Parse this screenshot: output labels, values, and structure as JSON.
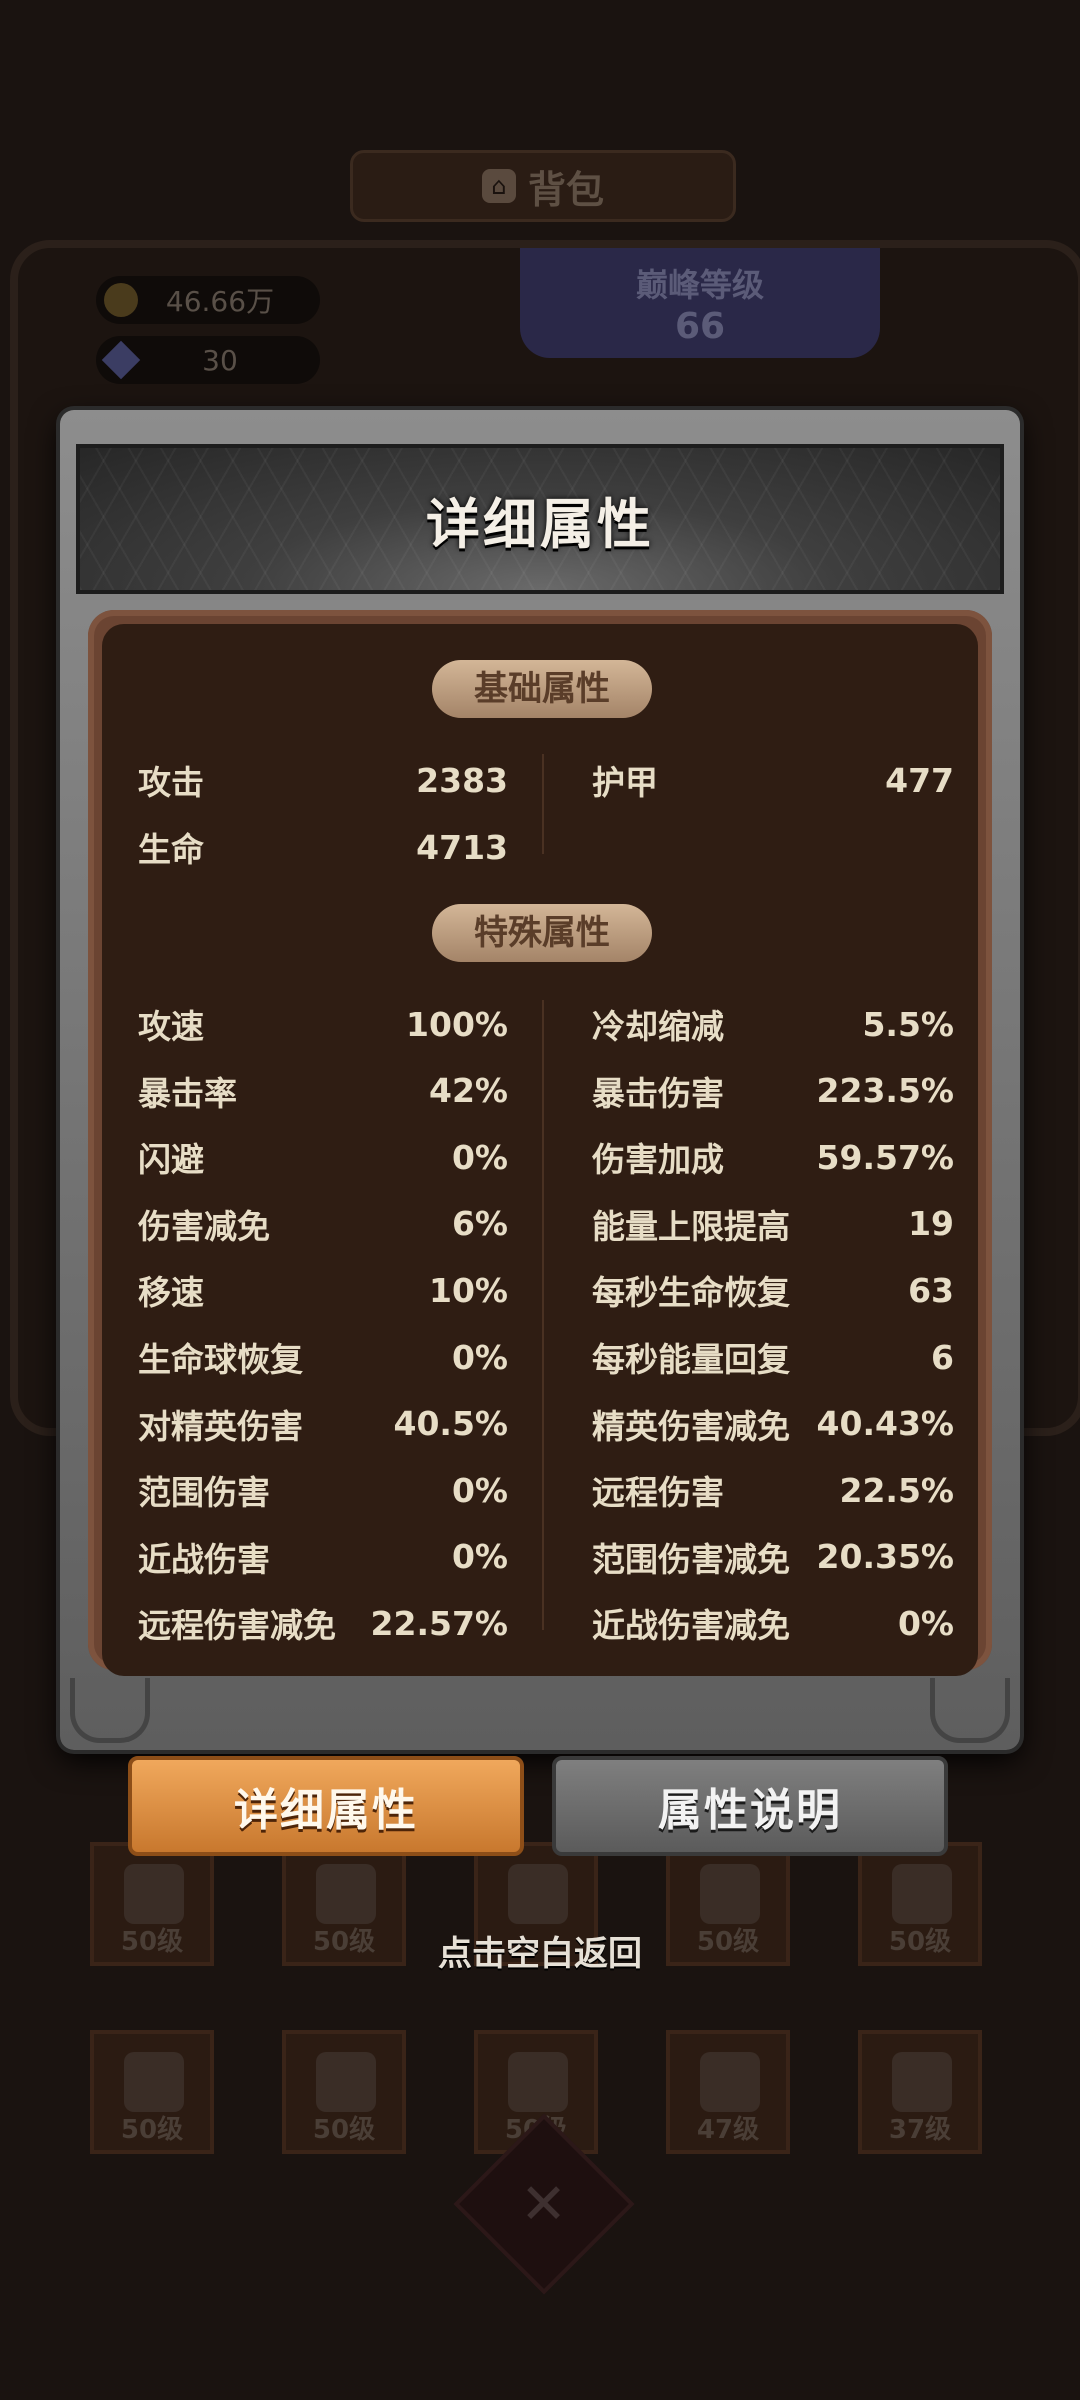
{
  "background": {
    "bag_title": "背包",
    "gold": "46.66万",
    "gems": "30",
    "peak_level_label": "巅峰等级",
    "peak_level_value": "66",
    "slot_levels_row1": [
      "50级",
      "50级",
      "",
      "50级",
      "50级"
    ],
    "slot_levels_row2": [
      "50级",
      "50级",
      "50级",
      "47级",
      "37级"
    ]
  },
  "panel": {
    "title": "详细属性",
    "basic_section": "基础属性",
    "special_section": "特殊属性",
    "basic_left": [
      {
        "label": "攻击",
        "value": "2383"
      },
      {
        "label": "生命",
        "value": "4713"
      }
    ],
    "basic_right": [
      {
        "label": "护甲",
        "value": "477"
      }
    ],
    "special_left": [
      {
        "label": "攻速",
        "value": "100%"
      },
      {
        "label": "暴击率",
        "value": "42%"
      },
      {
        "label": "闪避",
        "value": "0%"
      },
      {
        "label": "伤害减免",
        "value": "6%"
      },
      {
        "label": "移速",
        "value": "10%"
      },
      {
        "label": "生命球恢复",
        "value": "0%"
      },
      {
        "label": "对精英伤害",
        "value": "40.5%"
      },
      {
        "label": "范围伤害",
        "value": "0%"
      },
      {
        "label": "近战伤害",
        "value": "0%"
      },
      {
        "label": "远程伤害减免",
        "value": "22.57%"
      }
    ],
    "special_right": [
      {
        "label": "冷却缩减",
        "value": "5.5%"
      },
      {
        "label": "暴击伤害",
        "value": "223.5%"
      },
      {
        "label": "伤害加成",
        "value": "59.57%"
      },
      {
        "label": "能量上限提高",
        "value": "19"
      },
      {
        "label": "每秒生命恢复",
        "value": "63"
      },
      {
        "label": "每秒能量回复",
        "value": "6"
      },
      {
        "label": "精英伤害减免",
        "value": "40.43%"
      },
      {
        "label": "远程伤害",
        "value": "22.5%"
      },
      {
        "label": "范围伤害减免",
        "value": "20.35%"
      },
      {
        "label": "近战伤害减免",
        "value": "0%"
      }
    ]
  },
  "tabs": {
    "detail": "详细属性",
    "explain": "属性说明"
  },
  "hint": "点击空白返回"
}
